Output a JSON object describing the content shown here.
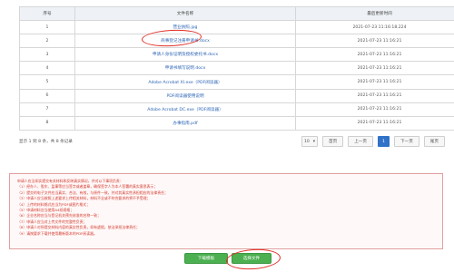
{
  "table": {
    "headers": [
      "序号",
      "文件名称",
      "最后更新时间"
    ],
    "rows": [
      {
        "index": "1",
        "name": "营业执照.jpg",
        "time": "2021-07-23 11:16:18.224"
      },
      {
        "index": "2",
        "name": "商事登记注册申请书.docx",
        "time": "2021-07-23 11:16:21"
      },
      {
        "index": "3",
        "name": "申请人身份证明及授权委托书.docx",
        "time": "2021-07-23 11:16:21"
      },
      {
        "index": "4",
        "name": "申请书填写说明.docx",
        "time": "2021-07-23 11:16:21"
      },
      {
        "index": "5",
        "name": "Adobe Acrobat XI.exe（PDF阅读器）",
        "time": "2021-07-23 11:16:21"
      },
      {
        "index": "6",
        "name": "PDF阅读器使用说明",
        "time": "2021-07-23 11:16:21"
      },
      {
        "index": "7",
        "name": "Adobe Acrobat DC.exe（PDF阅读器）",
        "time": "2021-07-23 11:16:21"
      },
      {
        "index": "8",
        "name": "办事指南.pdf",
        "time": "2021-07-23 11:16:21"
      }
    ]
  },
  "summary": "显示 1 到 8 条，共 8 条记录",
  "pager": {
    "page_size": "10",
    "first": "首页",
    "prev": "上一页",
    "current": "1",
    "next": "下一页",
    "last": "尾页"
  },
  "notice": {
    "lines": [
      "申请人应当如实提交有关材料和反映真实情况，并对以下事项负责：",
      "（1）经办人、股东、监事等应当签字或者盖章，确保签字人为本人签署的真实意思表示；",
      "（2）提交的电子文件应当真实、合法、有效，与原件一致，并对其真实性承担相应的法律责任；",
      "（3）申请人应当按照上述要求上传相关材料，材料不全或不符合要求的将不予受理；",
      "（4）上传的材料格式应当为PDF或图片格式；",
      "（5）申请材料应当使用A4纸规格；",
      "（6）企业名称应当与登记机关预先核准的名称一致；",
      "（7）申请人应当对上传文件的完整性负责；",
      "（8）申请人对所提交材料内容的真实性负责，如有虚假，依法承担法律责任；",
      "（9）请按要求下载并使用最新版本的PDF阅读器。"
    ]
  },
  "buttons": {
    "template": "下载模板",
    "choose": "选择文件"
  },
  "colors": {
    "link": "#2f67b7",
    "accent": "#2f72c7",
    "notice_text": "#d23b2f",
    "button": "#4caf50",
    "annotation": "#e2312a"
  }
}
